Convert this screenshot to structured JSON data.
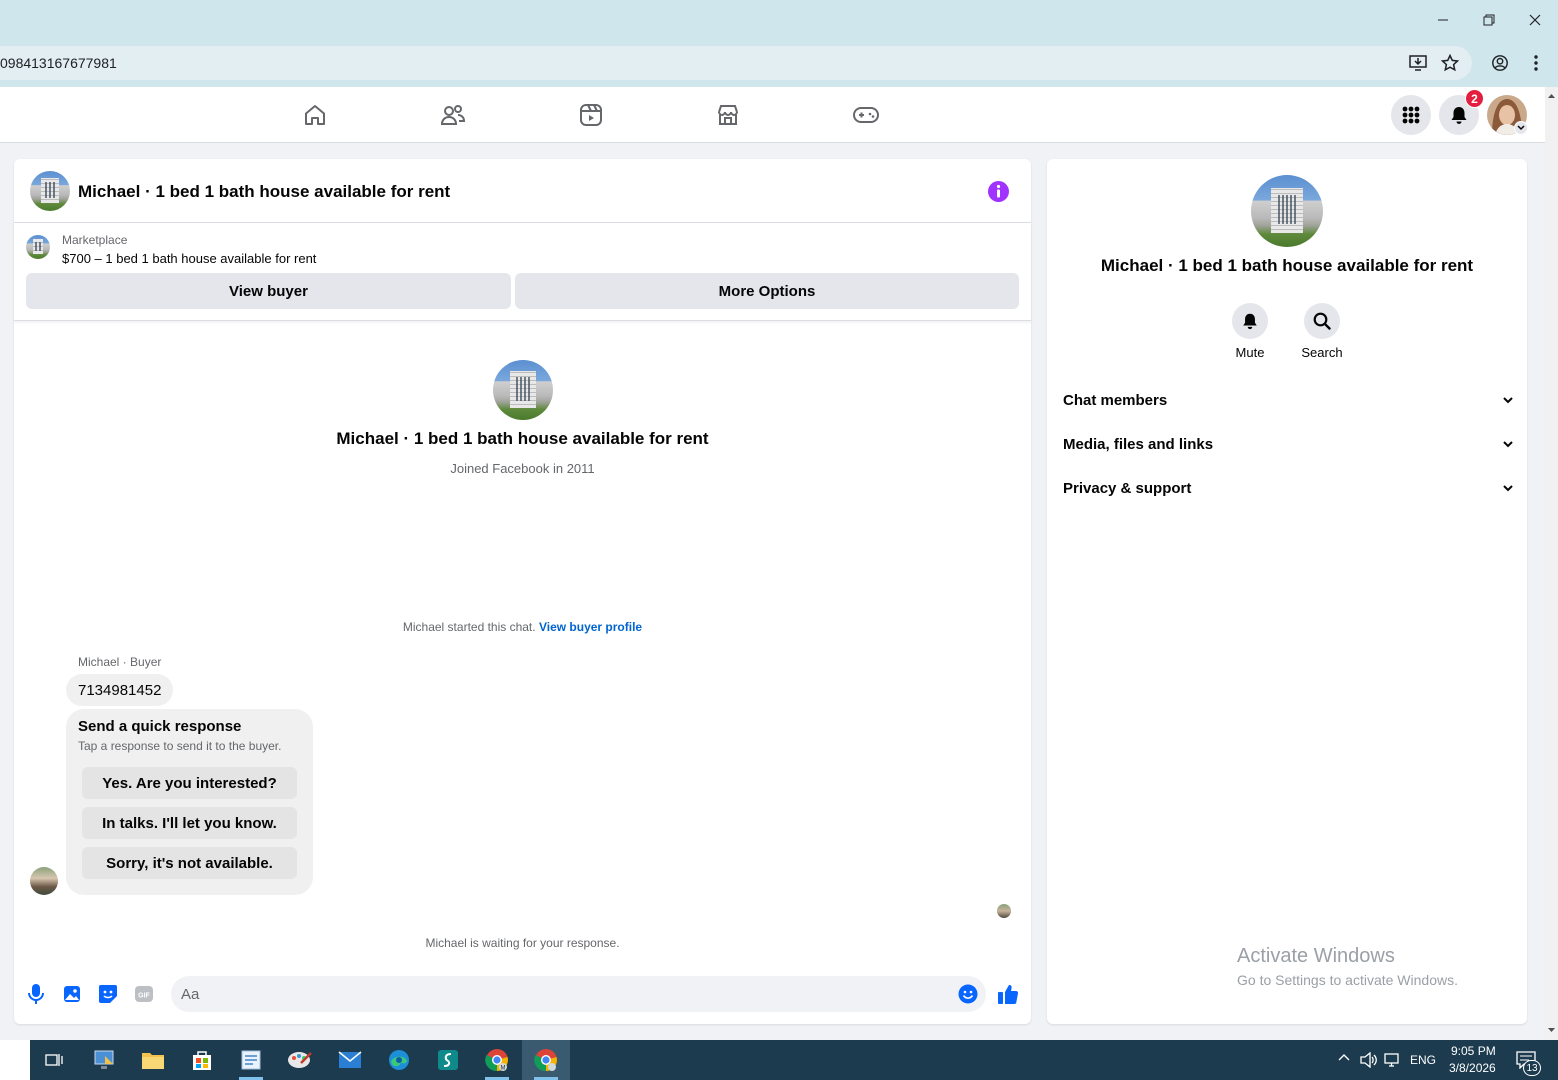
{
  "browser": {
    "url": "098413167677981",
    "window_controls": [
      "minimize-icon",
      "restore-icon",
      "close-icon"
    ],
    "toolbar_icons": [
      "install-app-icon",
      "bookmark-star-icon",
      "profile-icon",
      "more-vert-icon"
    ]
  },
  "fb_nav": {
    "tabs": [
      "home-icon",
      "friends-icon",
      "video-icon",
      "marketplace-icon",
      "gaming-icon"
    ],
    "notification_count": "2"
  },
  "chat": {
    "title": "Michael · 1 bed 1 bath house available for rent",
    "marketplace_label": "Marketplace",
    "listing": "$700 – 1 bed 1 bath house available for rent",
    "view_buyer_label": "View buyer",
    "more_options_label": "More Options",
    "intro_title": "Michael · 1 bed 1 bath house available for rent",
    "intro_joined": "Joined Facebook in 2011",
    "started_text": "Michael started this chat.",
    "view_buyer_profile": "View buyer profile",
    "sender_label": "Michael · Buyer",
    "message": "7134981452",
    "quick_response": {
      "title": "Send a quick response",
      "subtitle": "Tap a response to send it to the buyer.",
      "options": [
        "Yes. Are you interested?",
        "In talks. I'll let you know.",
        "Sorry, it's not available."
      ]
    },
    "waiting_text": "Michael is waiting for your response.",
    "composer_placeholder": "Aa"
  },
  "info_panel": {
    "title": "Michael · 1 bed 1 bath house available for rent",
    "actions": [
      {
        "label": "Mute",
        "icon": "bell-icon"
      },
      {
        "label": "Search",
        "icon": "search-icon"
      }
    ],
    "sections": [
      "Chat members",
      "Media, files and links",
      "Privacy & support"
    ]
  },
  "watermark": {
    "line1": "Activate Windows",
    "line2": "Go to Settings to activate Windows."
  },
  "taskbar": {
    "language": "ENG",
    "time": "9:05 PM",
    "date": "3/8/2026",
    "notification_count": "13"
  },
  "colors": {
    "fb_blue": "#0866ff",
    "messenger_purple": "#a033ff",
    "badge_red": "#e41e3f",
    "link_blue": "#0064d1"
  }
}
